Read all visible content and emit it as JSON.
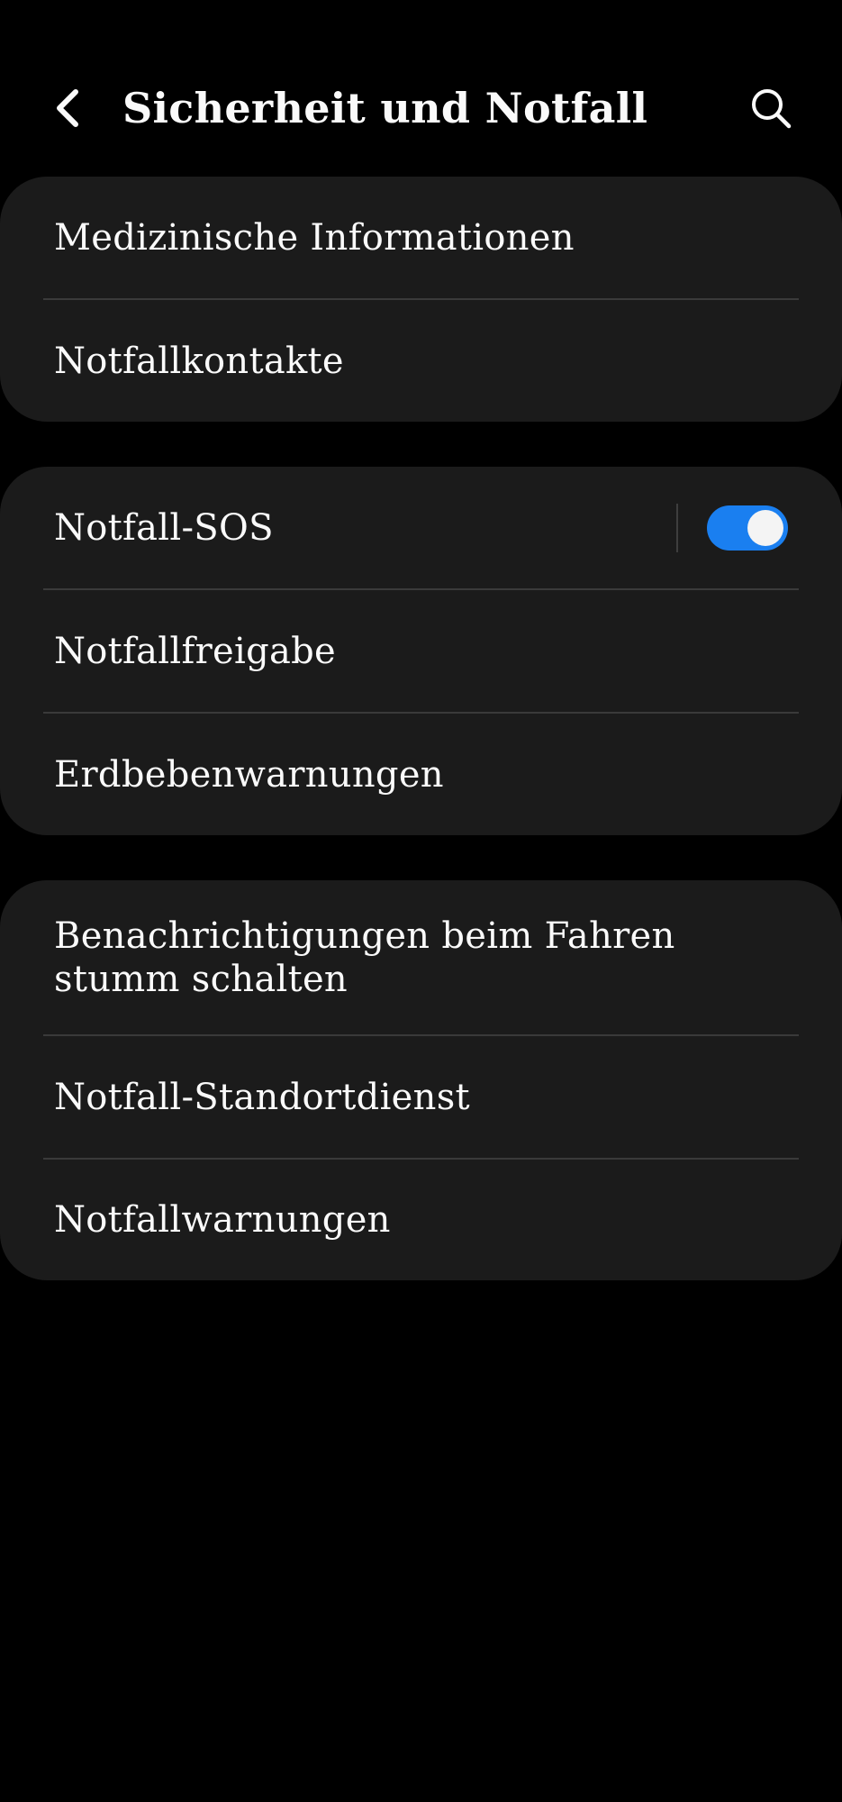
{
  "header": {
    "title": "Sicherheit und Notfall",
    "back_icon": "chevron-left-icon",
    "search_icon": "search-icon"
  },
  "groups": [
    {
      "items": [
        {
          "label": "Medizinische Informationen"
        },
        {
          "label": "Notfallkontakte"
        }
      ]
    },
    {
      "items": [
        {
          "label": "Notfall-SOS",
          "toggle": true
        },
        {
          "label": "Notfallfreigabe"
        },
        {
          "label": "Erdbebenwarnungen"
        }
      ]
    },
    {
      "items": [
        {
          "label": "Benachrichtigungen beim Fahren stumm schalten"
        },
        {
          "label": "Notfall-Standortdienst"
        },
        {
          "label": "Notfallwarnungen"
        }
      ]
    }
  ],
  "colors": {
    "background": "#000000",
    "card": "#1b1b1b",
    "divider": "#3a3a3a",
    "text": "#fafafa",
    "toggle_on": "#1a7ff0"
  }
}
